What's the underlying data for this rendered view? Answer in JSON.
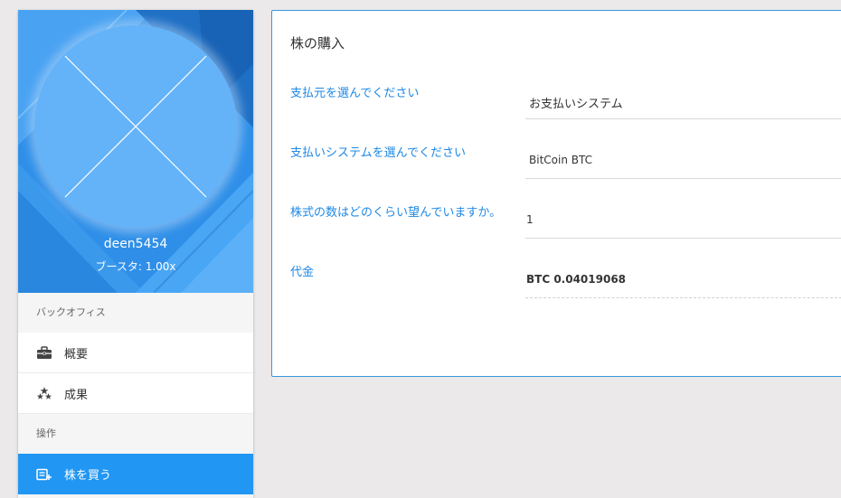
{
  "profile": {
    "username": "deen5454",
    "booster": "ブースタ: 1.00x"
  },
  "sidebar": {
    "sections": [
      {
        "label": "バックオフィス",
        "items": [
          {
            "label": "概要",
            "icon": "briefcase-icon"
          },
          {
            "label": "成果",
            "icon": "stars-icon"
          }
        ]
      },
      {
        "label": "操作",
        "items": [
          {
            "label": "株を買う",
            "icon": "cart-icon",
            "active": true
          }
        ]
      }
    ]
  },
  "purchase": {
    "title": "株の購入",
    "fields": [
      {
        "label": "支払元を選んでください",
        "value": "お支払いシステム"
      },
      {
        "label": "支払いシステムを選んでください",
        "value": "BitCoin BTC"
      },
      {
        "label": "株式の数はどのくらい望んでいますか。",
        "value": "1"
      },
      {
        "label": "代金",
        "value": "BTC 0.04019068"
      }
    ]
  },
  "colors": {
    "accent": "#2196f3",
    "label": "#1e88e5",
    "background": "#ebe9e9"
  }
}
